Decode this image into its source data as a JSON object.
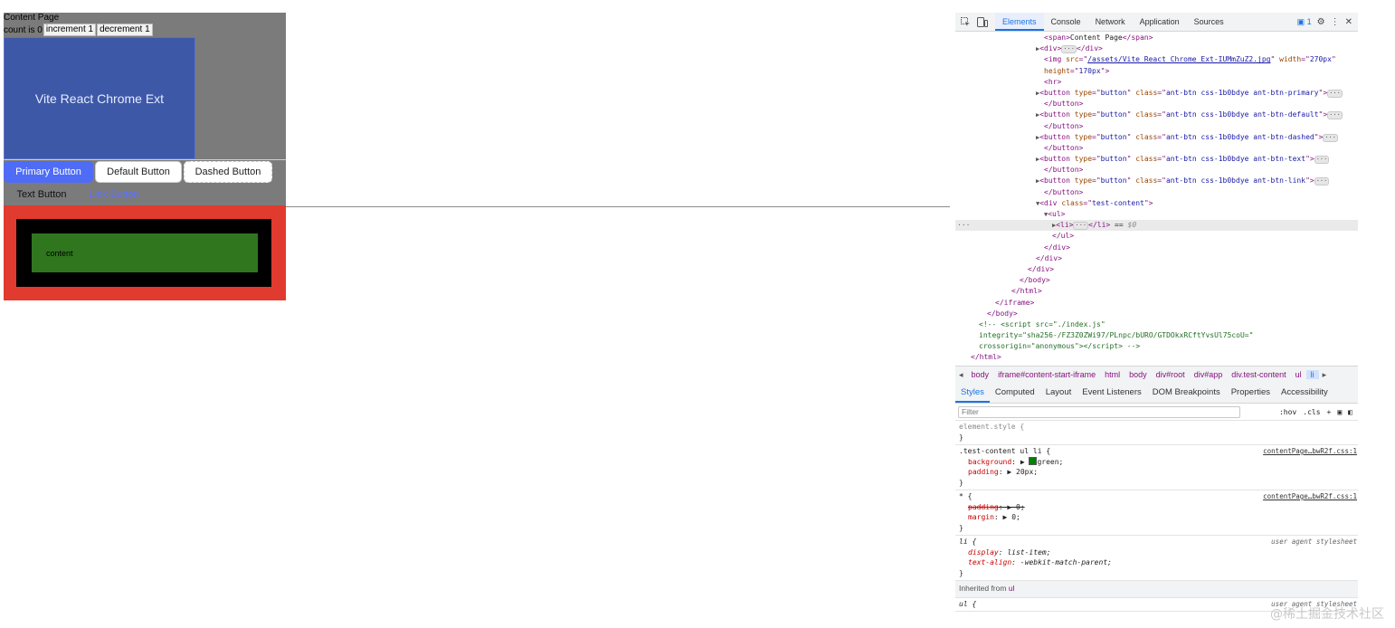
{
  "preview": {
    "title": "Content Page",
    "count_label": "count is 0",
    "increment_label": "increment 1",
    "decrement_label": "decrement 1",
    "banner_text": "Vite React Chrome Ext",
    "buttons": {
      "primary": "Primary Button",
      "default": "Default Button",
      "dashed": "Dashed Button",
      "text": "Text Button",
      "link": "Link Button"
    },
    "content_text": "content"
  },
  "devtools": {
    "tabs": [
      "Elements",
      "Console",
      "Network",
      "Application",
      "Sources"
    ],
    "active_tab": "Elements",
    "issues_badge": "1",
    "dom_lines": [
      {
        "indent": 10,
        "html": "<span class=\"tg\">&lt;span&gt;</span><span class=\"tx\">Content Page</span><span class=\"tg\">&lt;/span&gt;</span>"
      },
      {
        "indent": 9,
        "arrow": "▶",
        "html": "<span class=\"tg\">&lt;div&gt;</span><span class=\"ell\">···</span><span class=\"tg\">&lt;/div&gt;</span>"
      },
      {
        "indent": 10,
        "html": "<span class=\"tg\">&lt;img </span><span class=\"an\">src</span><span class=\"tg\">=\"</span><span class=\"av link\">/assets/Vite React Chrome Ext-IUMmZuZ2.jpg</span><span class=\"tg\">\" </span><span class=\"an\">width</span><span class=\"tg\">=\"</span><span class=\"av\">270px</span><span class=\"tg\">\"</span>"
      },
      {
        "indent": 10,
        "html": "<span class=\"an\">height</span><span class=\"tg\">=\"</span><span class=\"av\">170px</span><span class=\"tg\">\"&gt;</span>"
      },
      {
        "indent": 10,
        "html": "<span class=\"tg\">&lt;hr&gt;</span>"
      },
      {
        "indent": 9,
        "arrow": "▶",
        "html": "<span class=\"tg\">&lt;button </span><span class=\"an\">type</span><span class=\"tg\">=\"</span><span class=\"av\">button</span><span class=\"tg\">\" </span><span class=\"an\">class</span><span class=\"tg\">=\"</span><span class=\"av\">ant-btn css-1b0bdye ant-btn-primary</span><span class=\"tg\">\"&gt;</span><span class=\"ell\">···</span>"
      },
      {
        "indent": 10,
        "html": "<span class=\"tg\">&lt;/button&gt;</span>"
      },
      {
        "indent": 9,
        "arrow": "▶",
        "html": "<span class=\"tg\">&lt;button </span><span class=\"an\">type</span><span class=\"tg\">=\"</span><span class=\"av\">button</span><span class=\"tg\">\" </span><span class=\"an\">class</span><span class=\"tg\">=\"</span><span class=\"av\">ant-btn css-1b0bdye ant-btn-default</span><span class=\"tg\">\"&gt;</span><span class=\"ell\">···</span>"
      },
      {
        "indent": 10,
        "html": "<span class=\"tg\">&lt;/button&gt;</span>"
      },
      {
        "indent": 9,
        "arrow": "▶",
        "html": "<span class=\"tg\">&lt;button </span><span class=\"an\">type</span><span class=\"tg\">=\"</span><span class=\"av\">button</span><span class=\"tg\">\" </span><span class=\"an\">class</span><span class=\"tg\">=\"</span><span class=\"av\">ant-btn css-1b0bdye ant-btn-dashed</span><span class=\"tg\">\"&gt;</span><span class=\"ell\">···</span>"
      },
      {
        "indent": 10,
        "html": "<span class=\"tg\">&lt;/button&gt;</span>"
      },
      {
        "indent": 9,
        "arrow": "▶",
        "html": "<span class=\"tg\">&lt;button </span><span class=\"an\">type</span><span class=\"tg\">=\"</span><span class=\"av\">button</span><span class=\"tg\">\" </span><span class=\"an\">class</span><span class=\"tg\">=\"</span><span class=\"av\">ant-btn css-1b0bdye ant-btn-text</span><span class=\"tg\">\"&gt;</span><span class=\"ell\">···</span>"
      },
      {
        "indent": 10,
        "html": "<span class=\"tg\">&lt;/button&gt;</span>"
      },
      {
        "indent": 9,
        "arrow": "▶",
        "html": "<span class=\"tg\">&lt;button </span><span class=\"an\">type</span><span class=\"tg\">=\"</span><span class=\"av\">button</span><span class=\"tg\">\" </span><span class=\"an\">class</span><span class=\"tg\">=\"</span><span class=\"av\">ant-btn css-1b0bdye ant-btn-link</span><span class=\"tg\">\"&gt;</span><span class=\"ell\">···</span>"
      },
      {
        "indent": 10,
        "html": "<span class=\"tg\">&lt;/button&gt;</span>"
      },
      {
        "indent": 9,
        "arrow": "▼",
        "html": "<span class=\"tg\">&lt;div </span><span class=\"an\">class</span><span class=\"tg\">=\"</span><span class=\"av\">test-content</span><span class=\"tg\">\"&gt;</span>"
      },
      {
        "indent": 10,
        "arrow": "▼",
        "html": "<span class=\"tg\">&lt;ul&gt;</span>"
      },
      {
        "indent": 11,
        "arrow": "▶",
        "sel": true,
        "html": "<span class=\"tg\">&lt;li&gt;</span><span class=\"ell\">···</span><span class=\"tg\">&lt;/li&gt;</span><span class=\"tx\"> == </span><span class=\"tx\" style=\"color:#888;font-style:italic\">$0</span>"
      },
      {
        "indent": 11,
        "html": "<span class=\"tg\">&lt;/ul&gt;</span>"
      },
      {
        "indent": 10,
        "html": "<span class=\"tg\">&lt;/div&gt;</span>"
      },
      {
        "indent": 9,
        "html": "<span class=\"tg\">&lt;/div&gt;</span>"
      },
      {
        "indent": 8,
        "html": "<span class=\"tg\">&lt;/div&gt;</span>"
      },
      {
        "indent": 7,
        "html": "<span class=\"tg\">&lt;/body&gt;</span>"
      },
      {
        "indent": 6,
        "html": "<span class=\"tg\">&lt;/html&gt;</span>"
      },
      {
        "indent": 4,
        "html": "<span class=\"tg\">&lt;/iframe&gt;</span>"
      },
      {
        "indent": 3,
        "html": "<span class=\"tg\">&lt;/body&gt;</span>"
      },
      {
        "indent": 2,
        "html": "<span class=\"cm\">&lt;!-- &lt;script src=\"./index.js\"</span>"
      },
      {
        "indent": 2,
        "html": "<span class=\"cm\">integrity=\"sha256-/FZ3Z0ZWi97/PLnpc/bURO/GTDOkxRCftYvsUl75coU=\"</span>"
      },
      {
        "indent": 2,
        "html": "<span class=\"cm\">crossorigin=\"anonymous\"&gt;&lt;/script&gt; --&gt;</span>"
      },
      {
        "indent": 1,
        "html": "<span class=\"tg\">&lt;/html&gt;</span>"
      }
    ],
    "breadcrumbs": [
      "body",
      "iframe#content-start-iframe",
      "html",
      "body",
      "div#root",
      "div#app",
      "div.test-content",
      "ul",
      "li"
    ],
    "subtabs": [
      "Styles",
      "Computed",
      "Layout",
      "Event Listeners",
      "DOM Breakpoints",
      "Properties",
      "Accessibility"
    ],
    "active_subtab": "Styles",
    "filter_placeholder": "Filter",
    "tool_hov": ":hov",
    "tool_cls": ".cls",
    "rules": [
      {
        "selector": "element.style {",
        "dim": true,
        "props": [],
        "close": "}"
      },
      {
        "selector": ".test-content ul li {",
        "source": "contentPage…bwR2f.css:1",
        "props": [
          {
            "name": "background",
            "value": "green;",
            "swatch": true,
            "expand": true
          },
          {
            "name": "padding",
            "value": "20px;",
            "expand": true
          }
        ],
        "close": "}"
      },
      {
        "selector": "* {",
        "source": "contentPage…bwR2f.css:1",
        "props": [
          {
            "name": "padding",
            "value": "0;",
            "expand": true,
            "strike": true
          },
          {
            "name": "margin",
            "value": "0;",
            "expand": true
          }
        ],
        "close": "}"
      },
      {
        "selector": "li {",
        "source": "user agent stylesheet",
        "ua": true,
        "italic": true,
        "props": [
          {
            "name": "display",
            "value": "list-item;"
          },
          {
            "name": "text-align",
            "value": "-webkit-match-parent;"
          }
        ],
        "close": "}"
      }
    ],
    "inherited_label": "Inherited from",
    "inherited_tag": "ul",
    "last_rule": {
      "selector": "ul {",
      "source": "user agent stylesheet"
    }
  },
  "watermark": "@稀土掘金技术社区"
}
